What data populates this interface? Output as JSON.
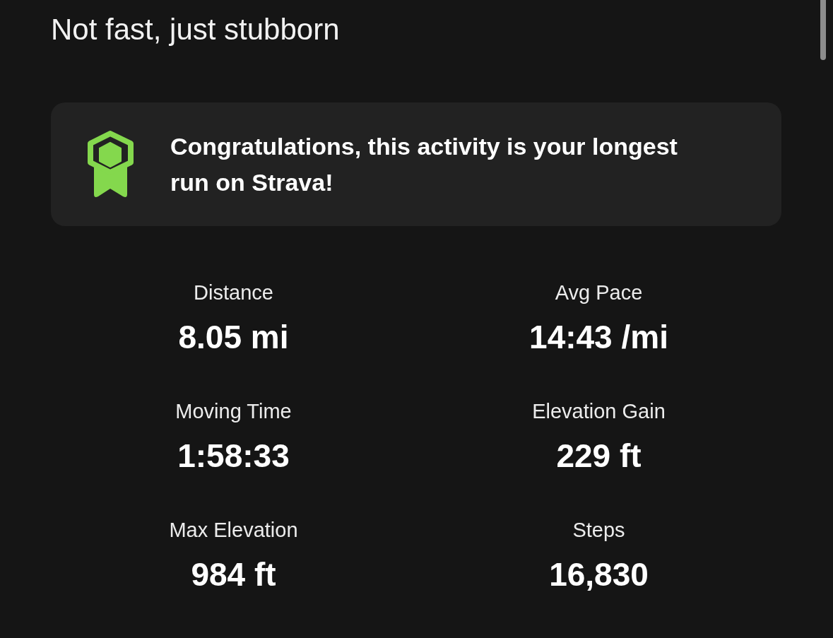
{
  "activity": {
    "title": "Not fast, just stubborn"
  },
  "achievement_banner": {
    "message": "Congratulations, this activity is your longest run on Strava!"
  },
  "stats": [
    {
      "label": "Distance",
      "value": "8.05 mi"
    },
    {
      "label": "Avg Pace",
      "value": "14:43 /mi"
    },
    {
      "label": "Moving Time",
      "value": "1:58:33"
    },
    {
      "label": "Elevation Gain",
      "value": "229 ft"
    },
    {
      "label": "Max Elevation",
      "value": "984 ft"
    },
    {
      "label": "Steps",
      "value": "16,830"
    }
  ]
}
